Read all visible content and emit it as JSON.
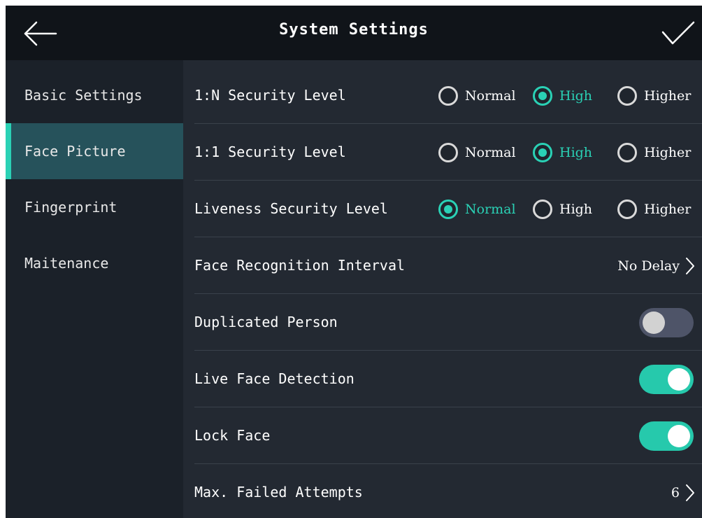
{
  "window": {
    "title": "System Settings"
  },
  "sidebar": {
    "items": [
      {
        "label": "Basic Settings"
      },
      {
        "label": "Face Picture",
        "active": true
      },
      {
        "label": "Fingerprint"
      },
      {
        "label": "Maitenance"
      }
    ]
  },
  "settings": {
    "n_security": {
      "label": "1:N Security Level",
      "options": [
        "Normal",
        "High",
        "Higher"
      ],
      "selected": "High"
    },
    "one_security": {
      "label": "1:1 Security Level",
      "options": [
        "Normal",
        "High",
        "Higher"
      ],
      "selected": "High"
    },
    "liveness_security": {
      "label": "Liveness Security Level",
      "options": [
        "Normal",
        "High",
        "Higher"
      ],
      "selected": "Normal"
    },
    "recognition_interval": {
      "label": "Face Recognition Interval",
      "value": "No Delay"
    },
    "duplicated_person": {
      "label": "Duplicated Person",
      "enabled": false
    },
    "live_face_detection": {
      "label": "Live Face Detection",
      "enabled": true
    },
    "lock_face": {
      "label": "Lock Face",
      "enabled": true
    },
    "max_failed_attempts": {
      "label": "Max. Failed Attempts",
      "value": "6"
    }
  },
  "colors": {
    "accent": "#2ad1b5",
    "titlebar": "#101419",
    "content_bg": "#232932",
    "sidebar_bg": "#1b2129",
    "sidebar_active": "#26525b",
    "toggle_off": "#4e5468"
  },
  "icons": {
    "back": "arrow-left-icon",
    "confirm": "check-icon",
    "row_chevron": "chevron-right-icon"
  }
}
